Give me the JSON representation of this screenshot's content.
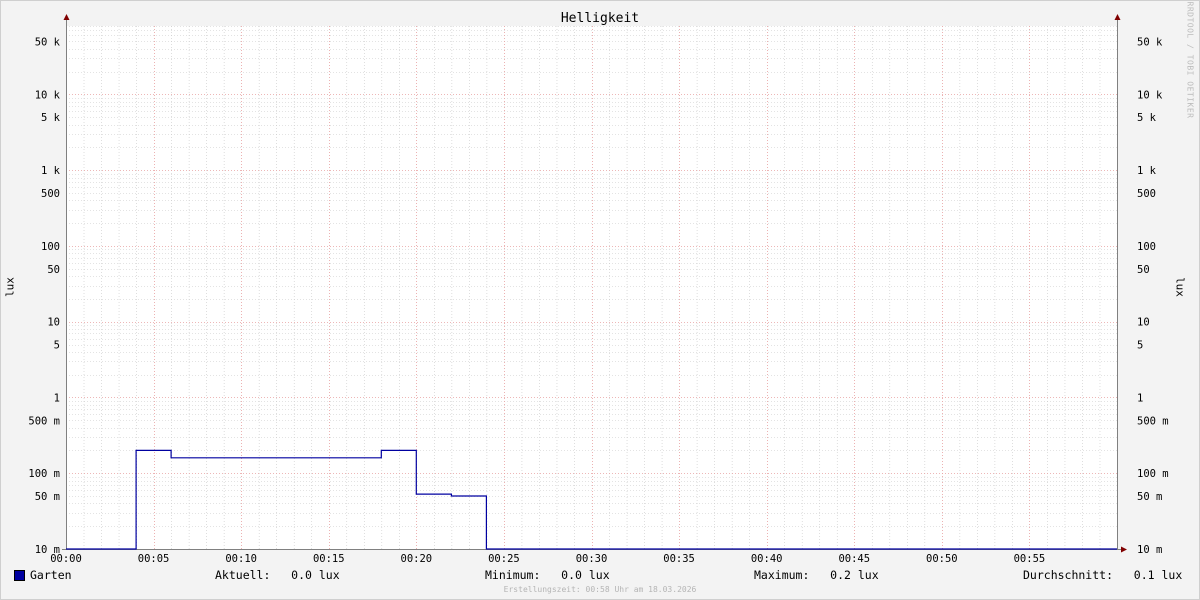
{
  "chart_data": {
    "type": "line",
    "title": "Helligkeit",
    "ylabel": "lux",
    "ylabel_right": "lux",
    "y_scale": "log",
    "ylim": [
      0.01,
      80000
    ],
    "xlim_minutes": [
      0,
      60
    ],
    "x_ticks": [
      {
        "value": 0,
        "label": "00:00"
      },
      {
        "value": 5,
        "label": "00:05"
      },
      {
        "value": 10,
        "label": "00:10"
      },
      {
        "value": 15,
        "label": "00:15"
      },
      {
        "value": 20,
        "label": "00:20"
      },
      {
        "value": 25,
        "label": "00:25"
      },
      {
        "value": 30,
        "label": "00:30"
      },
      {
        "value": 35,
        "label": "00:35"
      },
      {
        "value": 40,
        "label": "00:40"
      },
      {
        "value": 45,
        "label": "00:45"
      },
      {
        "value": 50,
        "label": "00:50"
      },
      {
        "value": 55,
        "label": "00:55"
      }
    ],
    "y_ticks": [
      {
        "value": 50000,
        "label": "50 k"
      },
      {
        "value": 10000,
        "label": "10 k"
      },
      {
        "value": 5000,
        "label": "5 k"
      },
      {
        "value": 1000,
        "label": "1 k"
      },
      {
        "value": 500,
        "label": "500"
      },
      {
        "value": 100,
        "label": "100"
      },
      {
        "value": 50,
        "label": "50"
      },
      {
        "value": 10,
        "label": "10"
      },
      {
        "value": 5,
        "label": "5"
      },
      {
        "value": 1,
        "label": "1"
      },
      {
        "value": 0.5,
        "label": "500 m"
      },
      {
        "value": 0.1,
        "label": "100 m"
      },
      {
        "value": 0.05,
        "label": "50 m"
      },
      {
        "value": 0.01,
        "label": "10 m"
      }
    ],
    "grid": true,
    "legend_position": "bottom",
    "series": [
      {
        "name": "Garten",
        "color": "#0000a0",
        "step": true,
        "points": [
          {
            "x": 0,
            "y": 0.01
          },
          {
            "x": 4,
            "y": 0.01
          },
          {
            "x": 4,
            "y": 0.2
          },
          {
            "x": 6,
            "y": 0.2
          },
          {
            "x": 6,
            "y": 0.16
          },
          {
            "x": 18,
            "y": 0.16
          },
          {
            "x": 18,
            "y": 0.2
          },
          {
            "x": 20,
            "y": 0.2
          },
          {
            "x": 20,
            "y": 0.053
          },
          {
            "x": 22,
            "y": 0.053
          },
          {
            "x": 22,
            "y": 0.05
          },
          {
            "x": 24,
            "y": 0.05
          },
          {
            "x": 24,
            "y": 0.01
          },
          {
            "x": 60,
            "y": 0.01
          }
        ]
      }
    ]
  },
  "legend": {
    "series_name": "Garten",
    "current": "Aktuell:   0.0 lux",
    "minimum": "Minimum:   0.0 lux",
    "maximum": "Maximum:   0.2 lux",
    "average": "Durchschnitt:   0.1 lux"
  },
  "watermark": "RRDTOOL / TOBI OETIKER",
  "footer": "Erstellungszeit: 00:58 Uhr am 18.03.2026",
  "colors": {
    "major_grid": "#e8a0a0",
    "minor_grid": "#c8c8c8",
    "axis": "#808080",
    "arrow": "#800000",
    "plot_bg": "#ffffff",
    "page_bg": "#f3f3f3"
  }
}
